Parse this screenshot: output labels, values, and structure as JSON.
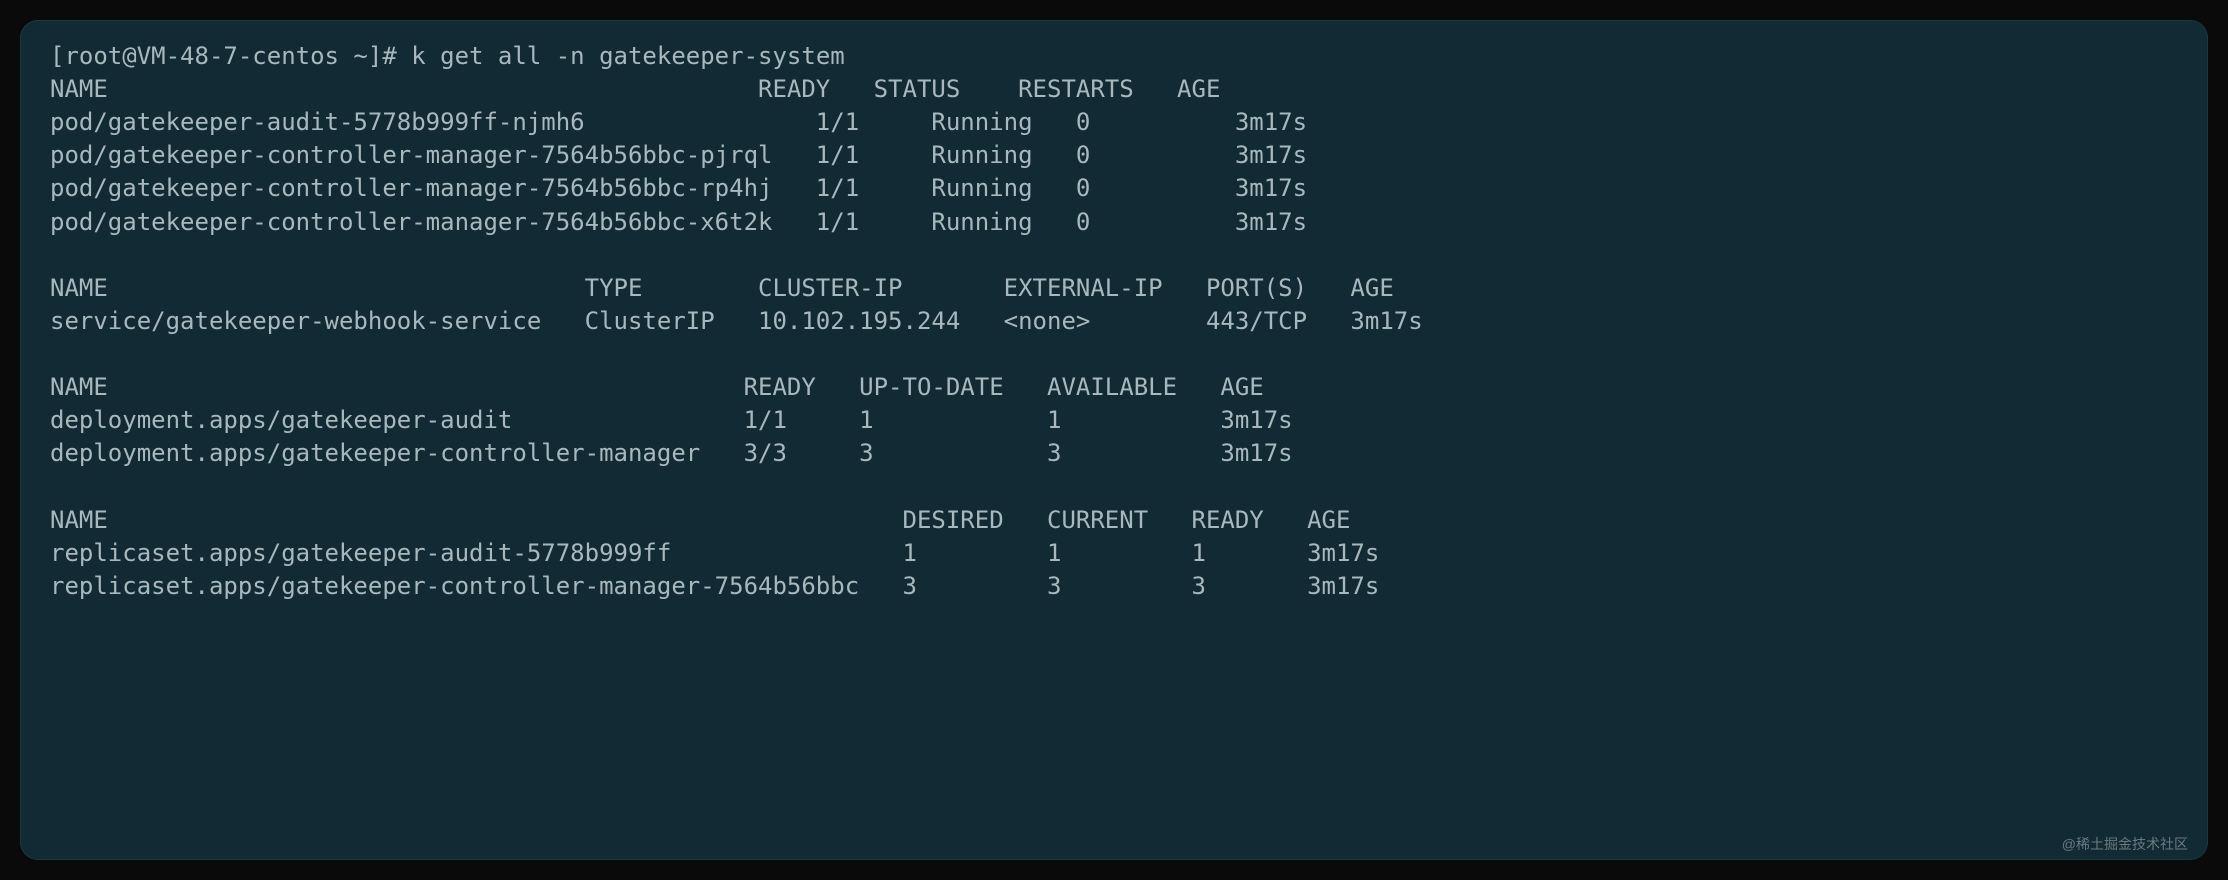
{
  "prompt": "[root@VM-48-7-centos ~]# ",
  "command": "k get all -n gatekeeper-system",
  "pods": {
    "header": "NAME                                             READY   STATUS    RESTARTS   AGE",
    "rows": [
      "pod/gatekeeper-audit-5778b999ff-njmh6                1/1     Running   0          3m17s",
      "pod/gatekeeper-controller-manager-7564b56bbc-pjrql   1/1     Running   0          3m17s",
      "pod/gatekeeper-controller-manager-7564b56bbc-rp4hj   1/1     Running   0          3m17s",
      "pod/gatekeeper-controller-manager-7564b56bbc-x6t2k   1/1     Running   0          3m17s"
    ]
  },
  "services": {
    "header": "NAME                                 TYPE        CLUSTER-IP       EXTERNAL-IP   PORT(S)   AGE",
    "rows": [
      "service/gatekeeper-webhook-service   ClusterIP   10.102.195.244   <none>        443/TCP   3m17s"
    ]
  },
  "deployments": {
    "header": "NAME                                            READY   UP-TO-DATE   AVAILABLE   AGE",
    "rows": [
      "deployment.apps/gatekeeper-audit                1/1     1            1           3m17s",
      "deployment.apps/gatekeeper-controller-manager   3/3     3            3           3m17s"
    ]
  },
  "replicasets": {
    "header": "NAME                                                       DESIRED   CURRENT   READY   AGE",
    "rows": [
      "replicaset.apps/gatekeeper-audit-5778b999ff                1         1         1       3m17s",
      "replicaset.apps/gatekeeper-controller-manager-7564b56bbc   3         3         3       3m17s"
    ]
  },
  "watermark": "@稀土掘金技术社区"
}
